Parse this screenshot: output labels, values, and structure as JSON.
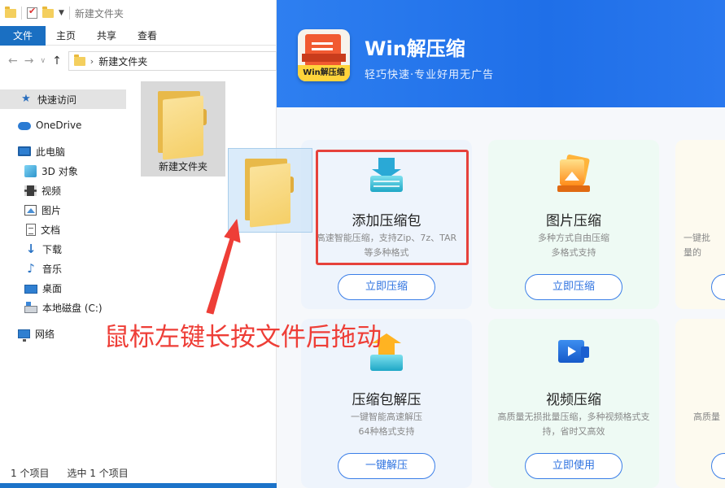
{
  "explorer": {
    "window_title": "新建文件夹",
    "ribbon_tabs": [
      "文件",
      "主页",
      "共享",
      "查看"
    ],
    "address_path": "新建文件夹",
    "nav": [
      {
        "label": "快速访问",
        "icon": "star-icon"
      },
      {
        "label": "OneDrive",
        "icon": "cloud-icon"
      },
      {
        "label": "此电脑",
        "icon": "computer-icon"
      },
      {
        "label": "3D 对象",
        "icon": "cube-icon"
      },
      {
        "label": "视频",
        "icon": "video-icon"
      },
      {
        "label": "图片",
        "icon": "picture-icon"
      },
      {
        "label": "文档",
        "icon": "document-icon"
      },
      {
        "label": "下载",
        "icon": "download-icon"
      },
      {
        "label": "音乐",
        "icon": "music-icon"
      },
      {
        "label": "桌面",
        "icon": "desktop-icon"
      },
      {
        "label": "本地磁盘 (C:)",
        "icon": "disk-icon"
      },
      {
        "label": "网络",
        "icon": "network-icon"
      }
    ],
    "content_items": [
      {
        "name": "新建文件夹",
        "type": "folder"
      }
    ],
    "status": {
      "count": "1 个项目",
      "selected": "选中 1 个项目"
    }
  },
  "app": {
    "name": "Win解压缩",
    "logo_label": "Win解压缩",
    "tagline": "轻巧快速·专业好用无广告",
    "cards": [
      {
        "title": "添加压缩包",
        "desc": "高速智能压缩，支持Zip、7z、TAR等多种格式",
        "button": "立即压缩",
        "icon": "add-archive-icon"
      },
      {
        "title": "图片压缩",
        "desc": "多种方式自由压缩\n多格式支持",
        "button": "立即压缩",
        "icon": "image-compress-icon"
      },
      {
        "title": "",
        "desc": "一键批\n量的",
        "button": "",
        "icon": ""
      },
      {
        "title": "压缩包解压",
        "desc": "一键智能高速解压\n64种格式支持",
        "button": "一键解压",
        "icon": "extract-icon"
      },
      {
        "title": "视频压缩",
        "desc": "高质量无损批量压缩，多种视频格式支持，省时又高效",
        "button": "立即使用",
        "icon": "video-compress-icon"
      },
      {
        "title": "",
        "desc": "高质量",
        "button": "",
        "icon": ""
      }
    ]
  },
  "annotation": {
    "text": "鼠标左键长按文件后拖动",
    "color": "#ee3e37"
  }
}
